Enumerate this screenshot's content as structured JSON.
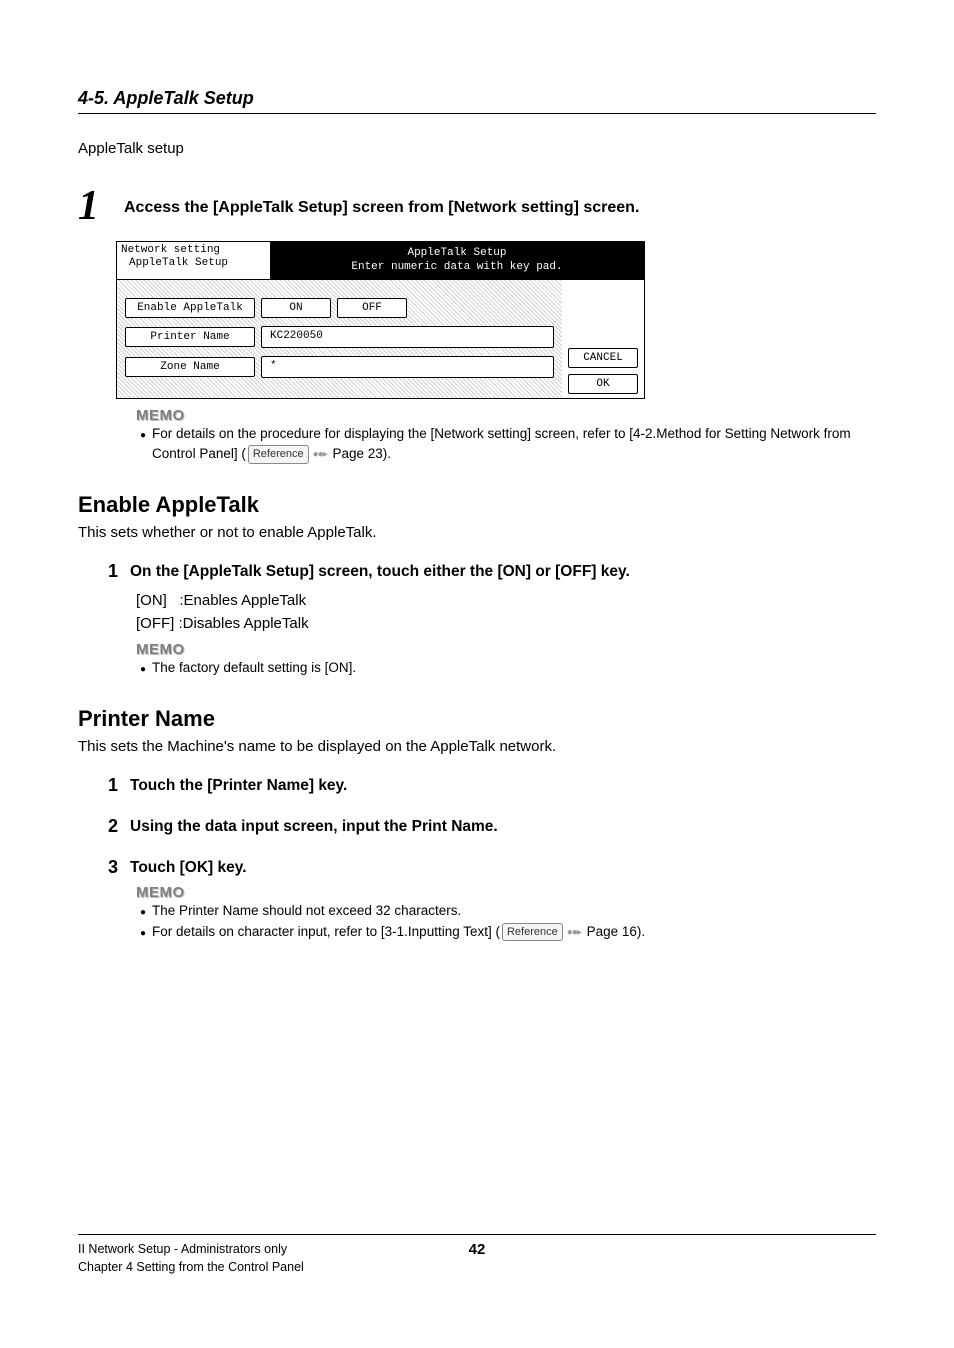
{
  "header": {
    "section_number_title": "4-5. AppleTalk Setup",
    "intro": "AppleTalk setup"
  },
  "step1": {
    "num": "1",
    "text": "Access the [AppleTalk Setup] screen from [Network setting] screen.",
    "shot": {
      "breadcrumb_top": "Network setting",
      "breadcrumb_sub": "AppleTalk Setup",
      "title": "AppleTalk Setup",
      "subtitle": "Enter numeric data with key pad.",
      "row_enable_label": "Enable AppleTalk",
      "btn_on": "ON",
      "btn_off": "OFF",
      "row_printer_label": "Printer Name",
      "printer_value": "KC220050",
      "row_zone_label": "Zone Name",
      "zone_value": "*",
      "btn_cancel": "CANCEL",
      "btn_ok": "OK"
    },
    "memo": {
      "title": "MEMO",
      "line1_a": "For details on the procedure for displaying the [Network setting] screen, refer to [4-2.Method for Setting Network from",
      "line1_b": "Control Panel] (",
      "ref": "Reference",
      "line1_c": " Page 23)."
    }
  },
  "enable_section": {
    "heading": "Enable AppleTalk",
    "desc": "This sets whether or not to enable AppleTalk.",
    "step": {
      "num": "1",
      "text": "On the [AppleTalk Setup] screen, touch either the [ON] or [OFF] key.",
      "opt_on": "[ON]   :Enables AppleTalk",
      "opt_off": "[OFF] :Disables AppleTalk"
    },
    "memo": {
      "title": "MEMO",
      "line": "The factory default setting is [ON]."
    }
  },
  "printer_section": {
    "heading": "Printer Name",
    "desc": "This sets the Machine's name to be displayed on the AppleTalk network.",
    "steps": [
      {
        "num": "1",
        "text": "Touch the [Printer Name] key."
      },
      {
        "num": "2",
        "text": "Using the data input screen, input the Print Name."
      },
      {
        "num": "3",
        "text": "Touch [OK] key."
      }
    ],
    "memo": {
      "title": "MEMO",
      "line1": "The Printer Name should not exceed 32 characters.",
      "line2_a": "For details on character input, refer to [3-1.Inputting Text] (",
      "ref": "Reference",
      "line2_b": " Page 16)."
    }
  },
  "footer": {
    "left1": "II Network Setup - Administrators only",
    "left2": "Chapter 4 Setting from the Control Panel",
    "page": "42"
  }
}
